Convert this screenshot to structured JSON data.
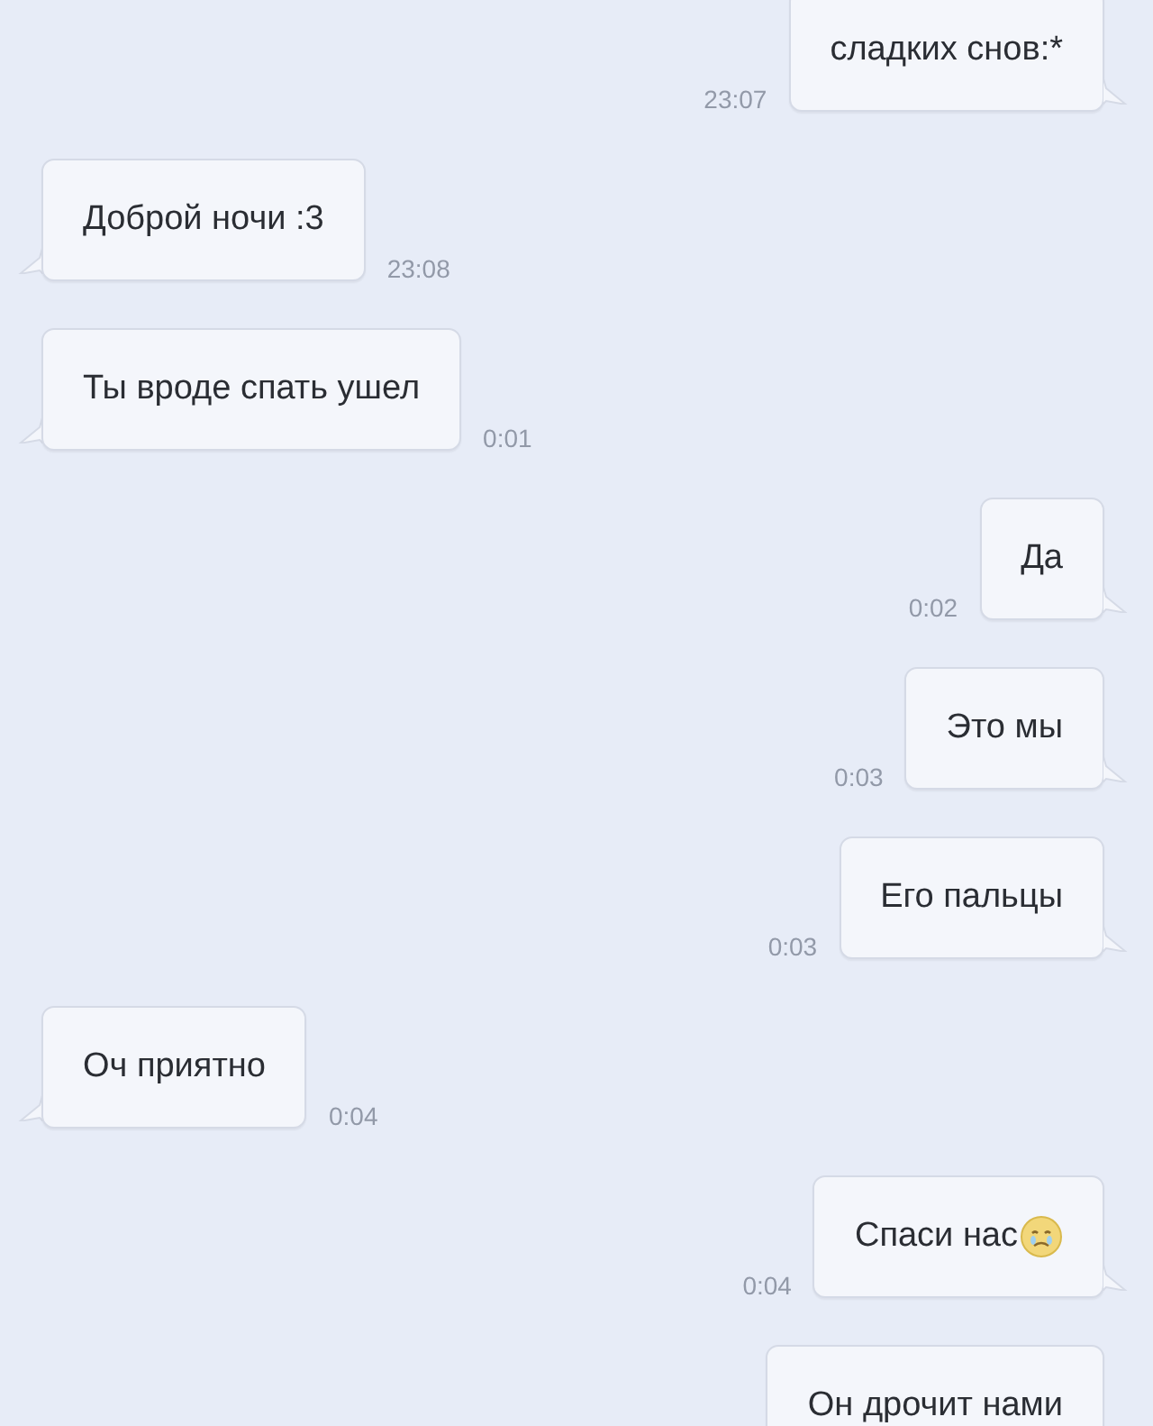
{
  "messages": [
    {
      "kind": "outgoing",
      "text": "сладких снов:*",
      "time": "23:07"
    },
    {
      "kind": "incoming",
      "text": "Доброй ночи :3",
      "time": "23:08"
    },
    {
      "kind": "incoming",
      "text": "Ты вроде спать ушел",
      "time": "0:01"
    },
    {
      "kind": "outgoing",
      "text": "Да",
      "time": "0:02"
    },
    {
      "kind": "outgoing",
      "text": "Это мы",
      "time": "0:03"
    },
    {
      "kind": "outgoing",
      "text": "Его пальцы",
      "time": "0:03"
    },
    {
      "kind": "incoming",
      "text": "Оч приятно",
      "time": "0:04"
    },
    {
      "kind": "outgoing",
      "text": "Спаси нас",
      "time": "0:04",
      "emoji": true
    },
    {
      "kind": "outgoing",
      "text": "Он дрочит нами"
    }
  ]
}
